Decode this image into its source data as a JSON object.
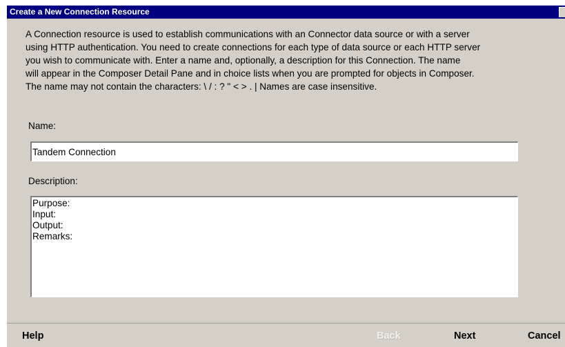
{
  "window": {
    "title": "Create a New Connection Resource"
  },
  "intro": {
    "text": "A Connection resource is used to establish communications with an Connector data source or with a server\nusing HTTP authentication. You need to create connections for each type of data source or each HTTP server\nyou wish to communicate with.  Enter a name and, optionally, a description for this Connection.  The name\nwill appear in the Composer Detail Pane and in choice lists when you are prompted for objects in Composer.\n The name may not contain the characters: \\ / : ? \" < > . |  Names are case insensitive."
  },
  "form": {
    "name_label": "Name:",
    "name_value": "Tandem Connection",
    "description_label": "Description:",
    "description_value": "Purpose:\nInput:\nOutput:\nRemarks:"
  },
  "footer": {
    "help_label": "Help",
    "back_label": "Back",
    "next_label": "Next",
    "cancel_label": "Cancel",
    "back_enabled": false
  },
  "colors": {
    "title_bar": "#000080",
    "panel": "#d4d0c8",
    "disabled_text": "#f2f0ec"
  }
}
